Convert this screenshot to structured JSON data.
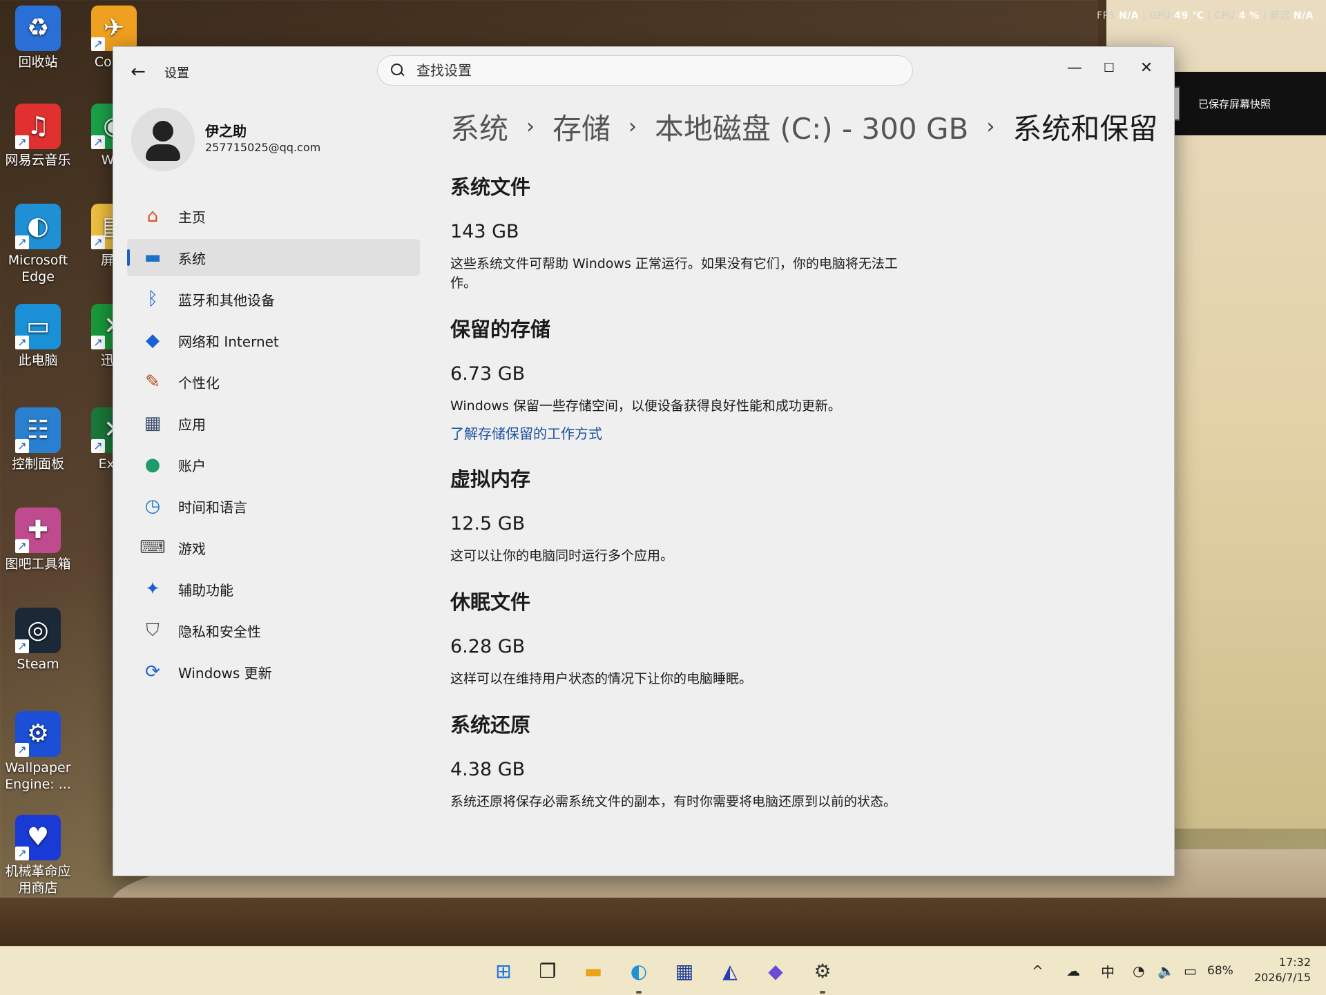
{
  "hud": {
    "fps_label": "FPS",
    "fps_value": "N/A",
    "gpu_label": "GPU",
    "gpu_value": "49 ℃",
    "cpu_label": "CPU",
    "cpu_value": "4 %",
    "latency_label": "延迟",
    "latency_value": "N/A"
  },
  "toast": {
    "text": "已保存屏幕快照"
  },
  "desktop_icons": [
    {
      "label": "回收站",
      "icon": "recycle-bin-icon"
    },
    {
      "label": "Count",
      "icon": "counter-strike-icon"
    },
    {
      "label": "网易云音乐",
      "icon": "netease-music-icon"
    },
    {
      "label": "We(",
      "icon": "wechat-icon"
    },
    {
      "label": "Microsoft Edge",
      "icon": "edge-icon"
    },
    {
      "label": "屏幕",
      "icon": "screen-icon"
    },
    {
      "label": "此电脑",
      "icon": "this-pc-icon"
    },
    {
      "label": "迅游",
      "icon": "xunyou-icon"
    },
    {
      "label": "控制面板",
      "icon": "control-panel-icon"
    },
    {
      "label": "Exce",
      "icon": "excel-icon"
    },
    {
      "label": "图吧工具箱",
      "icon": "tuba-toolbox-icon"
    },
    {
      "label": "Steam",
      "icon": "steam-icon"
    },
    {
      "label": "Wallpaper Engine: ...",
      "icon": "wallpaper-engine-icon"
    },
    {
      "label": "机械革命应用商店",
      "icon": "mechrevo-store-icon"
    }
  ],
  "window": {
    "app_title": "设置",
    "search_placeholder": "查找设置",
    "minimize": "—",
    "maximize": "☐",
    "close": "✕"
  },
  "profile": {
    "name": "伊之助",
    "email": "257715025@qq.com"
  },
  "nav": [
    {
      "label": "主页",
      "icon": "home-icon",
      "glyph": "⌂",
      "color": "#d9531e"
    },
    {
      "label": "系统",
      "icon": "system-icon",
      "glyph": "▬",
      "color": "#1a73c7",
      "active": true
    },
    {
      "label": "蓝牙和其他设备",
      "icon": "bluetooth-icon",
      "glyph": "ᛒ",
      "color": "#1a5fd6"
    },
    {
      "label": "网络和 Internet",
      "icon": "wifi-icon",
      "glyph": "◆",
      "color": "#1a5fd6"
    },
    {
      "label": "个性化",
      "icon": "brush-icon",
      "glyph": "✎",
      "color": "#b24a1a"
    },
    {
      "label": "应用",
      "icon": "apps-icon",
      "glyph": "▦",
      "color": "#3a4a6a"
    },
    {
      "label": "账户",
      "icon": "account-icon",
      "glyph": "●",
      "color": "#1f9a6a"
    },
    {
      "label": "时间和语言",
      "icon": "time-language-icon",
      "glyph": "◷",
      "color": "#1a73c7"
    },
    {
      "label": "游戏",
      "icon": "gamepad-icon",
      "glyph": "⌨",
      "color": "#555"
    },
    {
      "label": "辅助功能",
      "icon": "accessibility-icon",
      "glyph": "✦",
      "color": "#1a5fd6"
    },
    {
      "label": "隐私和安全性",
      "icon": "shield-icon",
      "glyph": "⛉",
      "color": "#555"
    },
    {
      "label": "Windows 更新",
      "icon": "update-icon",
      "glyph": "⟳",
      "color": "#1a5fd6"
    }
  ],
  "breadcrumb": [
    "系统",
    "存储",
    "本地磁盘 (C:) - 300 GB",
    "系统和保留"
  ],
  "sections": [
    {
      "title": "系统文件",
      "size": "143 GB",
      "desc": "这些系统文件可帮助 Windows 正常运行。如果没有它们，你的电脑将无法工作。"
    },
    {
      "title": "保留的存储",
      "size": "6.73 GB",
      "desc": "Windows 保留一些存储空间，以便设备获得良好性能和成功更新。",
      "link": "了解存储保留的工作方式"
    },
    {
      "title": "虚拟内存",
      "size": "12.5 GB",
      "desc": "这可以让你的电脑同时运行多个应用。"
    },
    {
      "title": "休眠文件",
      "size": "6.28 GB",
      "desc": "这样可以在维持用户状态的情况下让你的电脑睡眠。"
    },
    {
      "title": "系统还原",
      "size": "4.38 GB",
      "desc": "系统还原将保存必需系统文件的副本，有时你需要将电脑还原到以前的状态。"
    }
  ],
  "taskbar": {
    "apps": [
      {
        "name": "start-icon",
        "glyph": "⊞",
        "color": "#1a73e8"
      },
      {
        "name": "task-view-icon",
        "glyph": "❐",
        "color": "#222"
      },
      {
        "name": "file-explorer-icon",
        "glyph": "▬",
        "color": "#e8a317"
      },
      {
        "name": "edge-icon",
        "glyph": "◐",
        "color": "#1f8fd6"
      },
      {
        "name": "store-icon",
        "glyph": "▦",
        "color": "#1a3a9a"
      },
      {
        "name": "mechrevo-icon",
        "glyph": "◭",
        "color": "#2a3ab0"
      },
      {
        "name": "app-icon",
        "glyph": "◆",
        "color": "#6a4ad6"
      },
      {
        "name": "settings-icon",
        "glyph": "⚙",
        "color": "#333"
      }
    ],
    "tray": {
      "chevron": "^",
      "ime": "中",
      "battery": "68%",
      "time": "17:32",
      "date": "2026/7/15"
    }
  }
}
